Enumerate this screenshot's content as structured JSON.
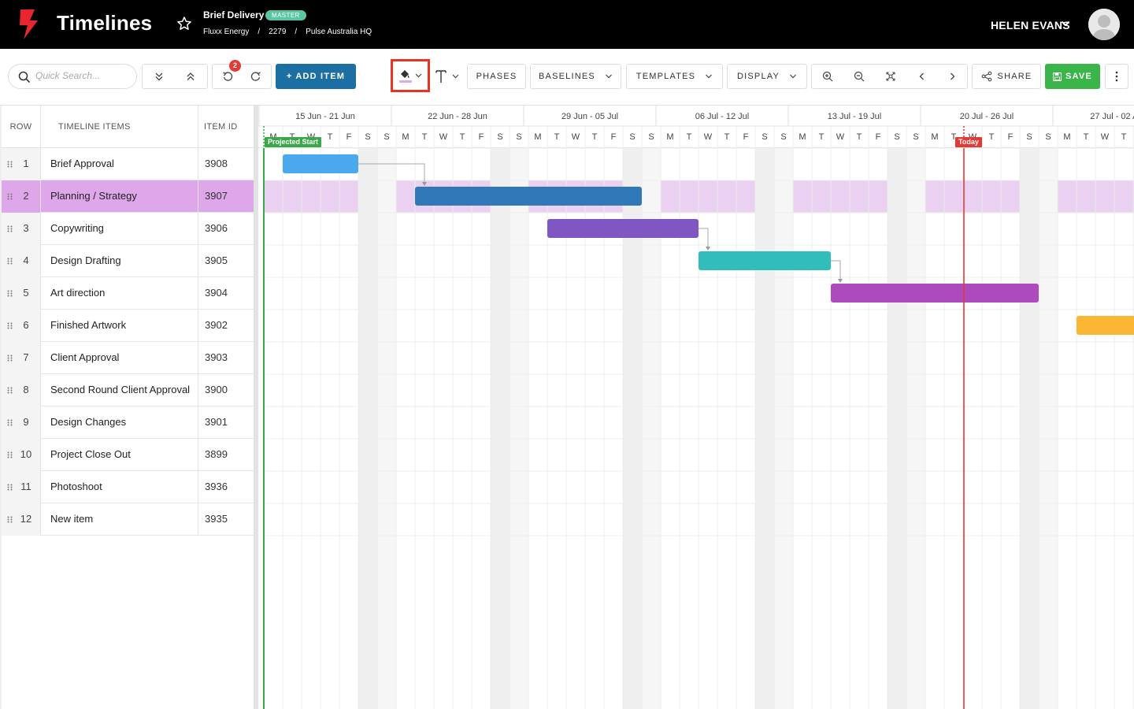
{
  "header": {
    "app_title": "Timelines",
    "project_name": "Brief Delivery",
    "badge": "MASTER",
    "breadcrumb": [
      "Fluxx Energy",
      "2279",
      "Pulse Australia HQ"
    ],
    "breadcrumb_separator": "/",
    "user_name": "HELEN EVANS"
  },
  "toolbar": {
    "search_placeholder": "Quick Search...",
    "undo_badge_count": "2",
    "add_item_label": "+ ADD ITEM",
    "phases_label": "PHASES",
    "baselines_label": "BASELINES",
    "templates_label": "TEMPLATES",
    "display_label": "DISPLAY",
    "share_label": "SHARE",
    "save_label": "SAVE",
    "accent_color": "#1c6fa3",
    "save_color": "#3ab54a"
  },
  "table": {
    "headers": {
      "row": "ROW",
      "items": "TIMELINE ITEMS",
      "item_id": "ITEM ID"
    },
    "selected_row": 2,
    "rows": [
      {
        "row": "1",
        "name": "Brief Approval",
        "id": "3908"
      },
      {
        "row": "2",
        "name": "Planning / Strategy",
        "id": "3907"
      },
      {
        "row": "3",
        "name": "Copywriting",
        "id": "3906"
      },
      {
        "row": "4",
        "name": "Design Drafting",
        "id": "3905"
      },
      {
        "row": "5",
        "name": "Art direction",
        "id": "3904"
      },
      {
        "row": "6",
        "name": "Finished Artwork",
        "id": "3902"
      },
      {
        "row": "7",
        "name": "Client Approval",
        "id": "3903"
      },
      {
        "row": "8",
        "name": "Second Round Client Approval",
        "id": "3900"
      },
      {
        "row": "9",
        "name": "Design Changes",
        "id": "3901"
      },
      {
        "row": "10",
        "name": "Project Close Out",
        "id": "3899"
      },
      {
        "row": "11",
        "name": "Photoshoot",
        "id": "3936"
      },
      {
        "row": "12",
        "name": "New item",
        "id": "3935"
      }
    ]
  },
  "gantt": {
    "weeks": [
      "15 Jun - 21 Jun",
      "22 Jun - 28 Jun",
      "29 Jun - 05 Jul",
      "06 Jul - 12 Jul",
      "13 Jul - 19 Jul",
      "20 Jul - 26 Jul",
      "27 Jul - 02 Aug"
    ],
    "days": [
      "M",
      "T",
      "W",
      "T",
      "F",
      "S",
      "S",
      "M",
      "T",
      "W",
      "T",
      "F",
      "S",
      "S",
      "M",
      "T",
      "W",
      "T",
      "F",
      "S",
      "S",
      "M",
      "T",
      "W",
      "T",
      "F",
      "S",
      "S",
      "M",
      "T",
      "W",
      "T",
      "F",
      "S",
      "S",
      "M",
      "T",
      "W",
      "T",
      "F",
      "S",
      "S",
      "M",
      "T",
      "W",
      "T",
      "F",
      "S",
      "S"
    ],
    "projected_start_label": "Projected Start",
    "today_label": "Today",
    "timeline_start": "2020-06-15",
    "projected_start_date": "2020-06-15",
    "today_date": "2020-07-22",
    "today_color": "#e53935",
    "projected_start_color": "#3aa848",
    "selected_row_color": "#dea7e9",
    "tasks": [
      {
        "row": 1,
        "start": "2020-06-16",
        "end": "2020-06-19",
        "color": "#4aa8ef"
      },
      {
        "row": 2,
        "start": "2020-06-23",
        "end": "2020-07-04",
        "color": "#3178b8"
      },
      {
        "row": 3,
        "start": "2020-06-30",
        "end": "2020-07-07",
        "color": "#7f56c2"
      },
      {
        "row": 4,
        "start": "2020-07-08",
        "end": "2020-07-14",
        "color": "#32bdbd"
      },
      {
        "row": 5,
        "start": "2020-07-15",
        "end": "2020-07-25",
        "color": "#ad4abd"
      },
      {
        "row": 6,
        "start": "2020-07-28",
        "end": "2020-07-31",
        "color": "#fbb635"
      }
    ],
    "dependencies": [
      [
        1,
        2
      ],
      [
        3,
        4
      ],
      [
        4,
        5
      ]
    ]
  }
}
